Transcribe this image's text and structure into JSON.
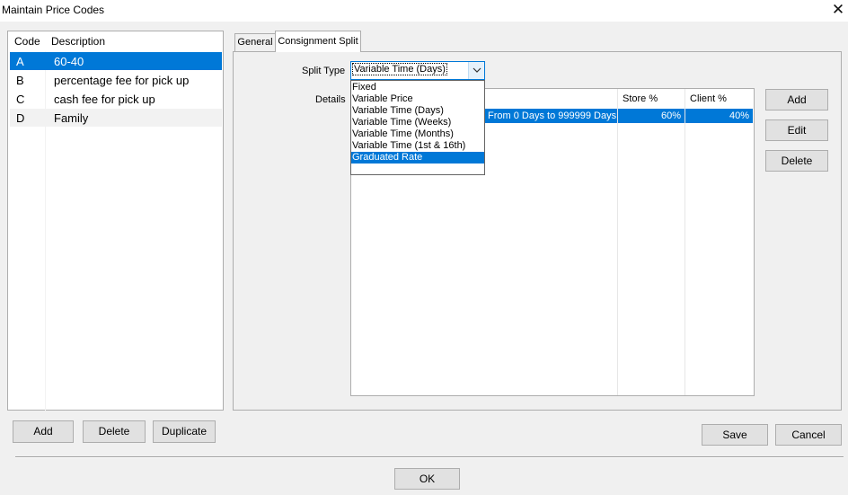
{
  "window": {
    "title": "Maintain Price Codes",
    "close_glyph": "✕"
  },
  "code_list": {
    "headers": {
      "code": "Code",
      "description": "Description"
    },
    "rows": [
      {
        "code": "A",
        "description": "60-40"
      },
      {
        "code": "B",
        "description": "percentage fee for pick up"
      },
      {
        "code": "C",
        "description": "cash fee for pick up"
      },
      {
        "code": "D",
        "description": "Family"
      }
    ],
    "selected_index": 0
  },
  "list_buttons": {
    "add": "Add",
    "delete": "Delete",
    "duplicate": "Duplicate"
  },
  "tabs": {
    "general": "General",
    "consignment_split": "Consignment Split",
    "active": "consignment_split"
  },
  "split_type": {
    "label": "Split Type",
    "value": "Variable Time (Days)",
    "options": [
      "Fixed",
      "Variable Price",
      "Variable Time (Days)",
      "Variable Time (Weeks)",
      "Variable Time (Months)",
      "Variable Time (1st & 16th)",
      "Graduated Rate"
    ],
    "highlighted_option": "Graduated Rate"
  },
  "details": {
    "label": "Details",
    "columns": {
      "store": "Store %",
      "client": "Client %"
    },
    "rows": [
      {
        "range": "From 0 Days to 999999 Days",
        "store": "60%",
        "client": "40%"
      }
    ]
  },
  "detail_buttons": {
    "add": "Add",
    "edit": "Edit",
    "delete": "Delete"
  },
  "footer": {
    "save": "Save",
    "cancel": "Cancel",
    "ok": "OK"
  },
  "colors": {
    "selection": "#0078d7",
    "background": "#f0f0f0",
    "button": "#e1e1e1"
  }
}
